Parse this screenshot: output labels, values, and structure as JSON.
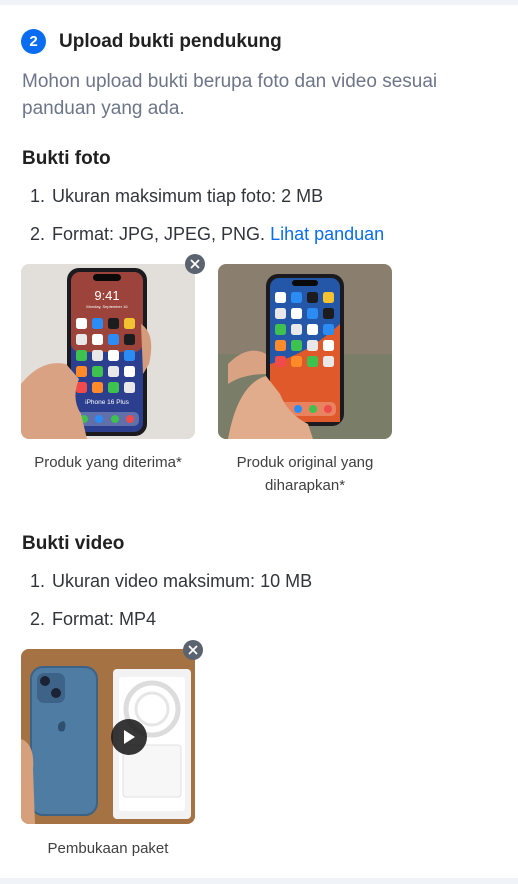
{
  "step": {
    "number": "2",
    "title": "Upload bukti pendukung",
    "description": "Mohon upload bukti berupa foto dan video sesuai panduan yang ada."
  },
  "photo_section": {
    "title": "Bukti foto",
    "rules": [
      {
        "num": "1.",
        "text": "Ukuran maksimum tiap foto: 2 MB"
      },
      {
        "num": "2.",
        "text": "Format: JPG, JPEG, PNG."
      }
    ],
    "guide_link": "Lihat panduan",
    "items": [
      {
        "caption": "Produk yang diterima*",
        "phone_label": "iPhone 16 Plus",
        "time": "9:41",
        "date": "Monday, September 16"
      },
      {
        "caption": "Produk original yang diharapkan*"
      }
    ]
  },
  "video_section": {
    "title": "Bukti video",
    "rules": [
      {
        "num": "1.",
        "text": "Ukuran video maksimum: 10 MB"
      },
      {
        "num": "2.",
        "text": "Format: MP4"
      }
    ],
    "items": [
      {
        "caption": "Pembukaan paket"
      }
    ]
  },
  "colors": {
    "accent": "#0a6cf0",
    "remove_button": "#5c6370",
    "description_text": "#6d7588"
  },
  "icons": {
    "remove": "close-icon",
    "play": "play-icon"
  }
}
